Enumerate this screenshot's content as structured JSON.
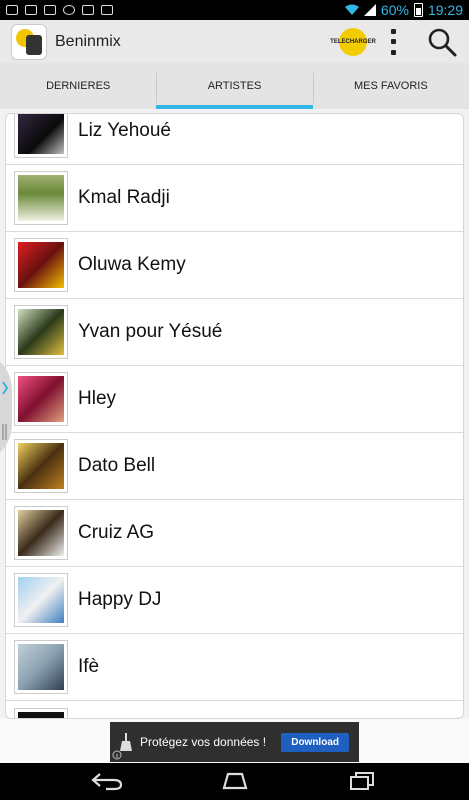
{
  "statusbar": {
    "battery": "60%",
    "time": "19:29"
  },
  "actionbar": {
    "app_title": "Beninmix",
    "ad_badge_text": "TELECHARGER"
  },
  "tabs": [
    {
      "label": "DERNIERES",
      "active": false
    },
    {
      "label": "ARTISTES",
      "active": true
    },
    {
      "label": "MES FAVORIS",
      "active": false
    }
  ],
  "artists": [
    {
      "name": "Liz Yehoué",
      "thumb_color": "#3a2a4a"
    },
    {
      "name": "Kmal Radji",
      "thumb_color": "#6a8a3a"
    },
    {
      "name": "Oluwa Kemy",
      "thumb_color": "#b02030"
    },
    {
      "name": "Yvan pour Yésué",
      "thumb_color": "#3a5a2a"
    },
    {
      "name": "Hley",
      "thumb_color": "#c03070"
    },
    {
      "name": "Dato Bell",
      "thumb_color": "#a08020"
    },
    {
      "name": "Cruiz AG",
      "thumb_color": "#7a6a4a"
    },
    {
      "name": "Happy DJ",
      "thumb_color": "#6aa0d0"
    },
    {
      "name": "Ifè",
      "thumb_color": "#8aa0b0"
    }
  ],
  "ad": {
    "text": "Protégez vos données !",
    "button": "Download"
  },
  "colors": {
    "accent": "#33b5e5",
    "actionbar": "#e9e9e9"
  },
  "icons": [
    "search-icon",
    "overflow-menu-icon",
    "back-icon",
    "home-icon",
    "recent-apps-icon",
    "wifi-icon",
    "signal-icon",
    "battery-icon"
  ]
}
